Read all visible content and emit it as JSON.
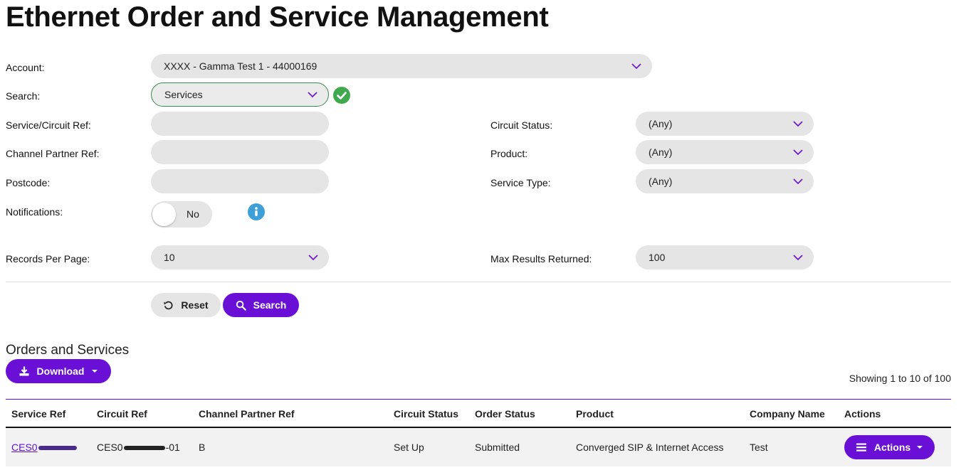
{
  "page": {
    "title": "Ethernet Order and Service Management"
  },
  "form": {
    "account_label": "Account:",
    "account_value": "XXXX - Gamma Test 1 - 44000169",
    "search_label": "Search:",
    "search_value": "Services",
    "service_ref_label": "Service/Circuit Ref:",
    "service_ref_value": "",
    "channel_partner_label": "Channel Partner Ref:",
    "channel_partner_value": "",
    "postcode_label": "Postcode:",
    "postcode_value": "",
    "notifications_label": "Notifications:",
    "notifications_value": "No",
    "records_per_page_label": "Records Per Page:",
    "records_per_page_value": "10",
    "circuit_status_label": "Circuit Status:",
    "circuit_status_value": "(Any)",
    "product_label": "Product:",
    "product_value": "(Any)",
    "service_type_label": "Service Type:",
    "service_type_value": "(Any)",
    "max_results_label": "Max Results Returned:",
    "max_results_value": "100"
  },
  "buttons": {
    "reset": "Reset",
    "search": "Search",
    "download": "Download",
    "actions": "Actions"
  },
  "results": {
    "section_title": "Orders and Services",
    "showing_text": "Showing 1 to 10 of 100",
    "columns": [
      "Service Ref",
      "Circuit Ref",
      "Channel Partner Ref",
      "Circuit Status",
      "Order Status",
      "Product",
      "Company Name",
      "Actions"
    ],
    "rows": [
      {
        "service_ref": "CES0",
        "circuit_ref_prefix": "CES0",
        "circuit_ref_suffix": "-01",
        "channel_partner_ref": "B",
        "circuit_status": "Set Up",
        "order_status": "Submitted",
        "product": "Converged SIP & Internet Access",
        "company_name": "Test"
      }
    ]
  },
  "colors": {
    "accent": "#6a0fd6",
    "valid": "#3fa94e",
    "info": "#3d9fd6",
    "field_bg": "#e5e5e5"
  },
  "icons": [
    "chevron-down-icon",
    "check-circle-icon",
    "info-icon",
    "reset-icon",
    "search-icon",
    "download-icon",
    "caret-down-icon",
    "menu-icon"
  ]
}
